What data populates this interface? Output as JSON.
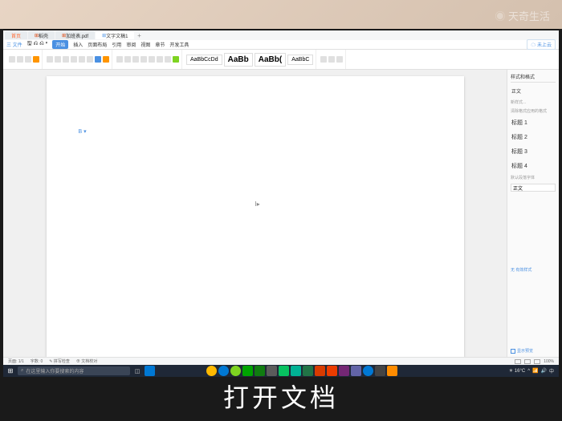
{
  "watermark": "天奇生活",
  "tabs": {
    "home": "首页",
    "doc1": "稻壳",
    "doc2": "加班表.pdf",
    "doc3": "文字文稿1"
  },
  "menu": {
    "file": "三 文件",
    "start": "开始",
    "insert": "插入",
    "layout": "页面布局",
    "ref": "引用",
    "review": "审阅",
    "view": "视图",
    "chapter": "章节",
    "dev": "开发工具",
    "cloud": "未上云"
  },
  "styles": {
    "s1": "AaBbCcDd",
    "s2": "AaBb",
    "s3": "AaBb(",
    "s4": "AaBbC"
  },
  "page_marker": "B ▾",
  "cursor": "I▸",
  "panel": {
    "title": "样式和格式",
    "normal": "正文",
    "new": "新样式...",
    "hint": "清除格式应用的格式",
    "h1": "标题 1",
    "h2": "标题 2",
    "h3": "标题 3",
    "h4": "标题 4",
    "font_label": "默认段落字体",
    "font_value": "正文",
    "bottom1": "无  有效样式",
    "bottom2": "显示预览"
  },
  "status": {
    "page": "页面: 1/1",
    "words": "字数: 0",
    "spell": "拼写检查",
    "doc": "文档校对",
    "zoom": "100%"
  },
  "taskbar": {
    "search_placeholder": "在这里输入你要搜索的内容",
    "weather": "16°C",
    "time": "中"
  },
  "subtitle": "打开文档",
  "colors": {
    "accent": "#4a90e2",
    "taskbar": "#1f2837",
    "icons": [
      "#0078d4",
      "#4a90e2",
      "#ffb900",
      "#7ed321",
      "#00a300",
      "#107c10",
      "#0f7b0f",
      "#5b5b5b",
      "#00b294",
      "#217346",
      "#d83b01",
      "#eb3c00",
      "#742774",
      "#6264a7",
      "#0078d4",
      "#444"
    ]
  }
}
